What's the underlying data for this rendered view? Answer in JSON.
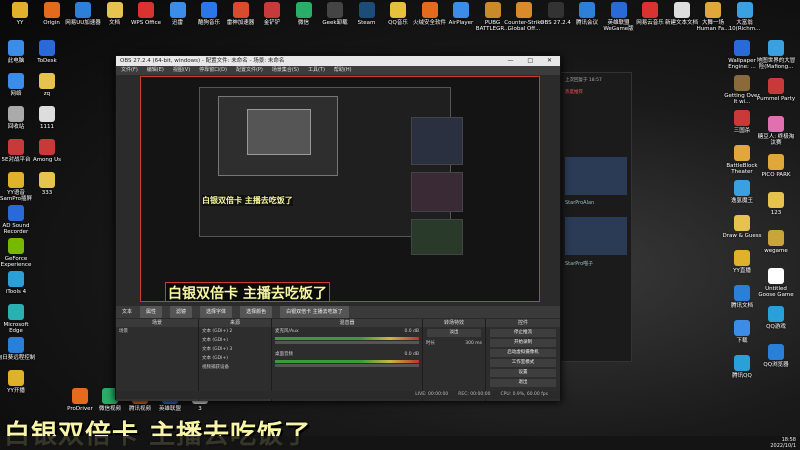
{
  "desktop_top_row": [
    {
      "label": "YY",
      "color": "#e0b22b"
    },
    {
      "label": "Origin",
      "color": "#e46a1e"
    },
    {
      "label": "网易UU加速器",
      "color": "#2d7fd8"
    },
    {
      "label": "文档",
      "color": "#e6c34e"
    },
    {
      "label": "WPS Office",
      "color": "#d9332f"
    },
    {
      "label": "迅雷",
      "color": "#3b8de8"
    },
    {
      "label": "酷狗音乐",
      "color": "#2b76e8"
    },
    {
      "label": "雷神加速器",
      "color": "#d94a2e"
    },
    {
      "label": "金铲铲",
      "color": "#c73a3a"
    },
    {
      "label": "微信",
      "color": "#2aae67"
    },
    {
      "label": "Geek卸载",
      "color": "#444"
    },
    {
      "label": "Steam",
      "color": "#1b4c7a"
    },
    {
      "label": "QQ音乐",
      "color": "#e5c13c"
    },
    {
      "label": "火绒安全软件",
      "color": "#e46a1e"
    },
    {
      "label": "AirPlayer",
      "color": "#3b8de8"
    },
    {
      "label": "PUBG BATTLEGR...",
      "color": "#c98a2a"
    },
    {
      "label": "Counter-Strike Global Off...",
      "color": "#d98a2a"
    },
    {
      "label": "OBS 27.2.4",
      "color": "#333"
    },
    {
      "label": "腾讯会议",
      "color": "#2d7fd8"
    },
    {
      "label": "英雄联盟WeGame版",
      "color": "#2a6ad8"
    },
    {
      "label": "网易云音乐",
      "color": "#d9332f"
    },
    {
      "label": "新建文本文档",
      "color": "#ddd"
    },
    {
      "label": "大舞一场Human Fa...",
      "color": "#e0a83a"
    },
    {
      "label": "大富翁10(Richm...",
      "color": "#3aa0e0"
    }
  ],
  "desktop_left_col": [
    {
      "label": "此电脑",
      "color": "#3b8de8"
    },
    {
      "label": "网络",
      "color": "#3b8de8"
    },
    {
      "label": "回收站",
      "color": "#aaa"
    },
    {
      "label": "5E对战平台",
      "color": "#c83a3a"
    },
    {
      "label": "YY语音 SamPro插屏",
      "color": "#e0b22b"
    },
    {
      "label": "AD Sound Recorder",
      "color": "#2a6ad8"
    },
    {
      "label": "GeForce Experience",
      "color": "#76b900"
    },
    {
      "label": "iTools 4",
      "color": "#2aa0d8"
    },
    {
      "label": "Microsoft Edge",
      "color": "#2ab0b0"
    },
    {
      "label": "向日葵远程控制",
      "color": "#2a7fd8"
    },
    {
      "label": "YY开播",
      "color": "#e0b22b"
    }
  ],
  "desktop_second_col": [
    {
      "label": "ToDesk",
      "color": "#2a6ad8"
    },
    {
      "label": "zq",
      "color": "#e6c34e"
    },
    {
      "label": "1111",
      "color": "#ddd"
    },
    {
      "label": "Among Us",
      "color": "#c83a3a"
    },
    {
      "label": "333",
      "color": "#e6c34e"
    }
  ],
  "desktop_right_col": [
    {
      "label": "Wallpaper Engine: ...",
      "color": "#2a6ad8"
    },
    {
      "label": "Getting Over It wi...",
      "color": "#8a6a3a"
    },
    {
      "label": "三国杀",
      "color": "#c83a3a"
    },
    {
      "label": "BattleBlock Theater",
      "color": "#e0a83a"
    },
    {
      "label": "逸氢魔王",
      "color": "#3aa0e0"
    },
    {
      "label": "Draw & Guess",
      "color": "#e6c34e"
    },
    {
      "label": "YY直播",
      "color": "#e0b22b"
    },
    {
      "label": "腾讯文档",
      "color": "#2a7fd8"
    },
    {
      "label": "下载",
      "color": "#3b8de8"
    },
    {
      "label": "腾讯QQ",
      "color": "#2aa0d8"
    }
  ],
  "desktop_far_right_col": [
    {
      "label": "地图世界的大冒险(Mafiong...",
      "color": "#3aa0e0"
    },
    {
      "label": "Pummel Party",
      "color": "#c83a3a"
    },
    {
      "label": "糖豆人: 终极淘汰赛",
      "color": "#e070b0"
    },
    {
      "label": "PICO PARK",
      "color": "#e0a83a"
    },
    {
      "label": "123",
      "color": "#e6c34e"
    },
    {
      "label": "wegame",
      "color": "#c9a43a"
    },
    {
      "label": "Untitled Goose Game",
      "color": "#fff"
    },
    {
      "label": "QQ游戏",
      "color": "#2aa0d8"
    },
    {
      "label": "QQ浏览器",
      "color": "#2a7fd8"
    }
  ],
  "desktop_bottom_row": [
    {
      "label": "ProDriver",
      "color": "#e46a1e"
    },
    {
      "label": "微信视频",
      "color": "#2aae67"
    },
    {
      "label": "腾讯视频",
      "color": "#e46a1e"
    },
    {
      "label": "英雄联盟",
      "color": "#2a6ad8"
    },
    {
      "label": "3",
      "color": "#ddd"
    }
  ],
  "obs": {
    "title": "OBS 27.2.4 (64-bit, windows) - 配置文件: 未命名 - 场景: 未命名",
    "window_buttons": "— □ ✕",
    "menu": [
      "文件(F)",
      "编辑(E)",
      "视图(V)",
      "停靠窗口(D)",
      "配置文件(P)",
      "场景集合(S)",
      "工具(T)",
      "帮助(H)"
    ],
    "overlay_caption": "白银双倍卡 主播去吃饭了",
    "toolstrip": {
      "source_label": "文本",
      "properties": "属性",
      "filters": "滤镜",
      "buttons": [
        "选择字体",
        "选择颜色"
      ],
      "text_value": "白银双倍卡 主播去吃饭了"
    },
    "docks": {
      "scenes": {
        "title": "场景",
        "items": [
          "场景"
        ]
      },
      "sources": {
        "title": "来源",
        "items": [
          "文本 (GDI+) 2",
          "文本 (GDI+)",
          "文本 (GDI+) 3",
          "文本 (GDI+)",
          "视频捕获设备"
        ]
      },
      "mixer": {
        "title": "混音器",
        "channels": [
          {
            "name": "麦克风/Aux",
            "db": "0.0 dB"
          },
          {
            "name": "桌面音频",
            "db": "0.0 dB"
          }
        ]
      },
      "transitions": {
        "title": "转场特效",
        "type": "淡出",
        "duration_label": "时长",
        "duration": "300 ms"
      },
      "controls": {
        "title": "控件",
        "buttons": [
          "停止推流",
          "开始录制",
          "启动虚拟摄像机",
          "工作室模式",
          "设置",
          "退出"
        ]
      }
    },
    "status": {
      "live": "LIVE: 00:00:00",
      "rec": "REC: 00:00:00",
      "cpu": "CPU: 0.9%, 60.00 fps"
    }
  },
  "chat_window": {
    "header": "上次回复于 18:57",
    "live_label": "热度推荐",
    "thumbs": [
      {
        "title": "StarProAlan"
      },
      {
        "title": "StarPro喵子"
      }
    ]
  },
  "big_caption": "白银双倍卡 主播去吃饭了",
  "clock": {
    "time": "18:58",
    "date": "2022/10/1"
  }
}
